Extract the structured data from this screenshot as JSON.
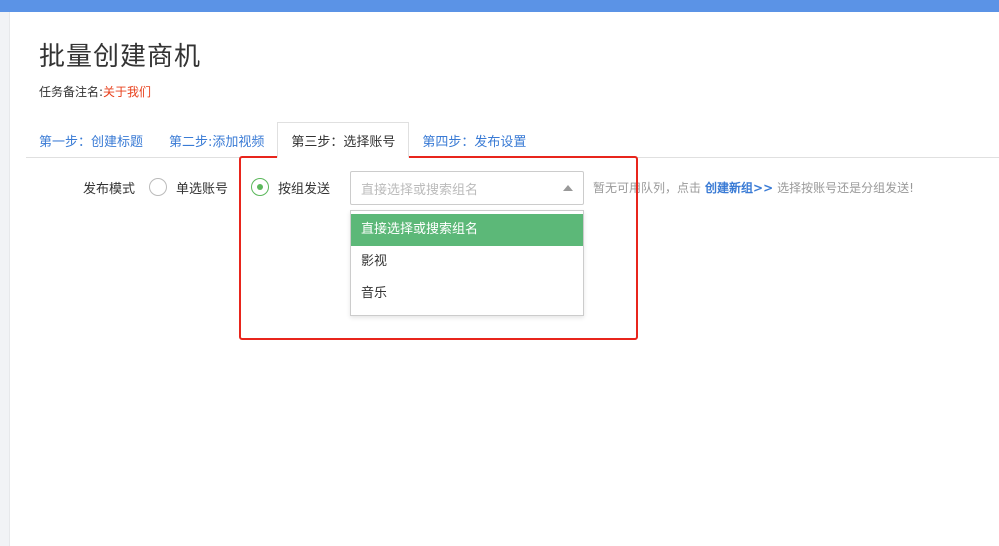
{
  "page": {
    "title": "批量创建商机",
    "remark_label": "任务备注名:",
    "remark_value": "关于我们"
  },
  "tabs": [
    {
      "label": "第一步：创建标题",
      "active": false
    },
    {
      "label": "第二步:添加视频",
      "active": false
    },
    {
      "label": "第三步：选择账号",
      "active": true
    },
    {
      "label": "第四步：发布设置",
      "active": false
    }
  ],
  "publish": {
    "mode_label": "发布模式",
    "options": [
      {
        "label": "单选账号",
        "checked": false
      },
      {
        "label": "按组发送",
        "checked": true
      }
    ],
    "select_placeholder": "直接选择或搜索组名",
    "hint_prefix": "暂无可用队列，点击",
    "hint_link": "创建新组>>",
    "hint_suffix": "选择按账号还是分组发送!",
    "dropdown_options": [
      {
        "label": "直接选择或搜索组名",
        "highlighted": true
      },
      {
        "label": "影视",
        "highlighted": false
      },
      {
        "label": "音乐",
        "highlighted": false
      }
    ]
  },
  "colors": {
    "topbar": "#5b93e6",
    "link": "#3a7bd5",
    "remark_value": "#e8401c",
    "highlight": "#5cb878",
    "annotation_box": "#e8251c"
  }
}
